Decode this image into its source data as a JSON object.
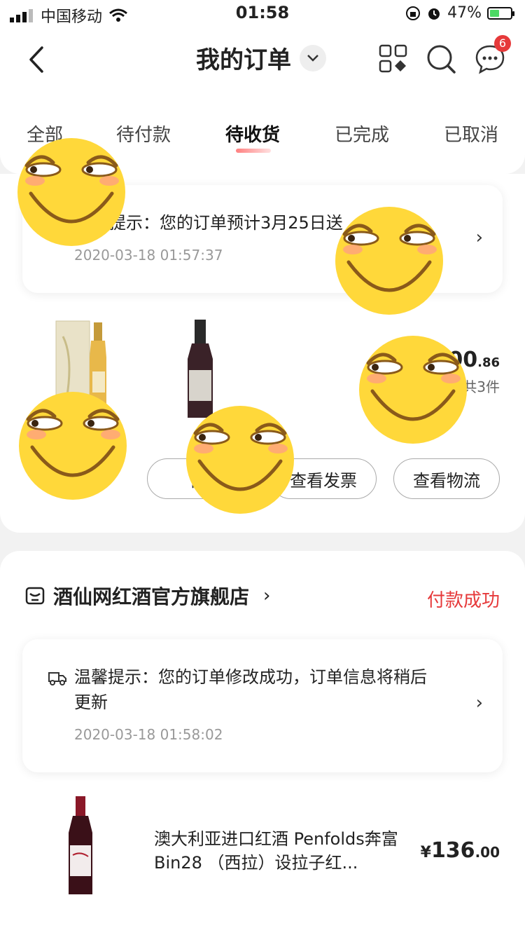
{
  "status_bar": {
    "carrier": "中国移动",
    "time": "01:58",
    "battery": "47%",
    "battery_level": 0.47
  },
  "nav": {
    "title": "我的订单",
    "message_badge": "6",
    "icons": [
      "back-arrow-icon",
      "chevron-down-icon",
      "apps-grid-icon",
      "search-icon",
      "message-icon"
    ]
  },
  "tabs": [
    {
      "label": "全部"
    },
    {
      "label": "待付款"
    },
    {
      "label": "待收货",
      "active": true
    },
    {
      "label": "已完成"
    },
    {
      "label": "已取消"
    }
  ],
  "order1": {
    "notice_prefix": "提示：",
    "notice_text": "您的订单预计3月25日送",
    "time": "2020-03-18 01:57:37",
    "price_tail": "00",
    "price_decimal": ".86",
    "count_text": "共3件",
    "buttons": {
      "modify": "修改",
      "invoice": "查看发票",
      "logistics": "查看物流"
    }
  },
  "order2": {
    "store": "酒仙网红酒官方旗舰店",
    "status": "付款成功",
    "notice_line1": "温馨提示：您的订单修改成功，订单信息将稍后",
    "notice_line2": "更新",
    "time": "2020-03-18 01:58:02",
    "product_name": "澳大利亚进口红酒 Penfolds奔富Bin28 （西拉）设拉子红...",
    "price_symbol": "¥",
    "price_int": "136",
    "price_decimal": ".00"
  },
  "colors": {
    "accent": "#e6393a",
    "emoji_face": "#ffd83a"
  }
}
